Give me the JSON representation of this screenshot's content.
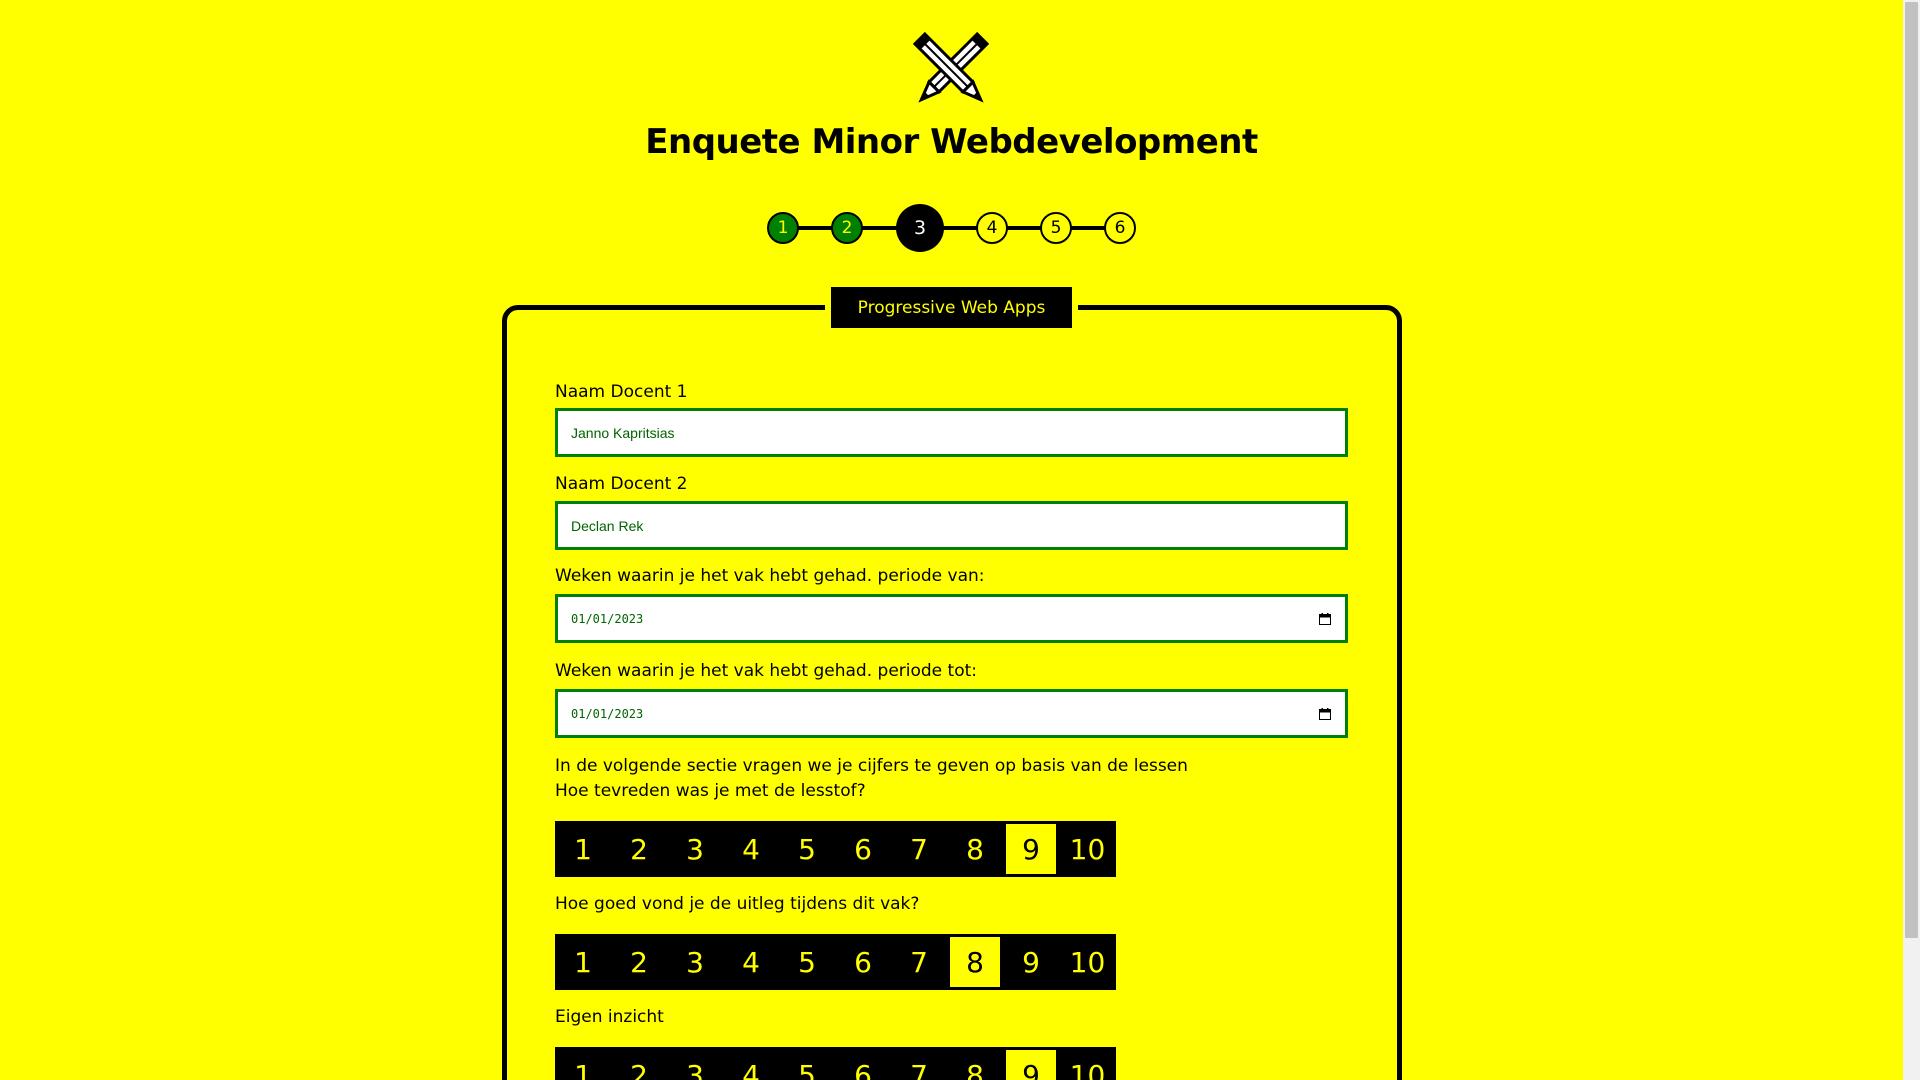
{
  "header": {
    "title": "Enquete Minor Webdevelopment",
    "logo_icon": "crossed-pencils-icon"
  },
  "stepper": {
    "steps": [
      {
        "label": "1",
        "state": "done"
      },
      {
        "label": "2",
        "state": "done"
      },
      {
        "label": "3",
        "state": "current"
      },
      {
        "label": "4",
        "state": "todo"
      },
      {
        "label": "5",
        "state": "todo"
      },
      {
        "label": "6",
        "state": "todo"
      }
    ]
  },
  "section": {
    "legend": "Progressive Web Apps",
    "fields": {
      "docent1": {
        "label": "Naam Docent 1",
        "value": "Janno Kapritsias"
      },
      "docent2": {
        "label": "Naam Docent 2",
        "value": "Declan Rek"
      },
      "periode_van": {
        "label": "Weken waarin je het vak hebt gehad. periode van:",
        "value": "01/01/2023"
      },
      "periode_tot": {
        "label": "Weken waarin je het vak hebt gehad. periode tot:",
        "value": "01/01/2023"
      }
    },
    "intro": "In de volgende sectie vragen we je cijfers te geven op basis van de lessen",
    "questions": [
      {
        "label": "Hoe tevreden was je met de lesstof?",
        "selected": 9
      },
      {
        "label": "Hoe goed vond je de uitleg tijdens dit vak?",
        "selected": 8
      },
      {
        "label": "Eigen inzicht",
        "selected": 9
      }
    ],
    "rating_options": [
      "1",
      "2",
      "3",
      "4",
      "5",
      "6",
      "7",
      "8",
      "9",
      "10"
    ]
  },
  "colors": {
    "background": "#ffff00",
    "accent": "#008000",
    "dark": "#000000"
  }
}
